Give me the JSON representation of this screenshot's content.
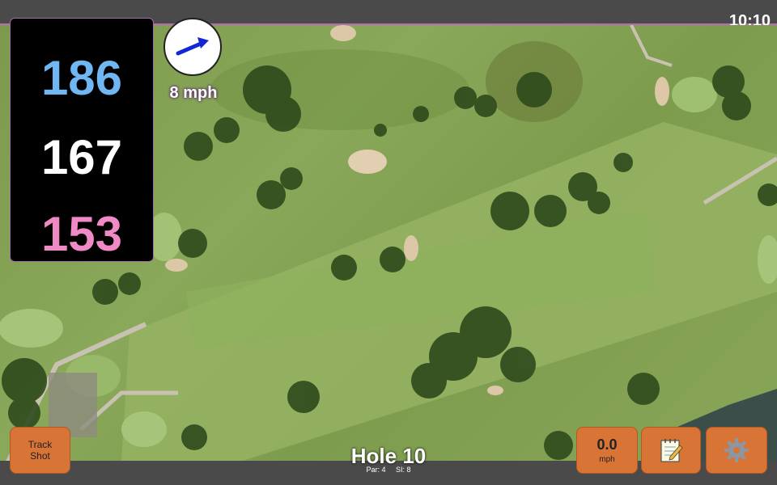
{
  "clock": "10:10",
  "distances": {
    "back": "186",
    "middle": "167",
    "front": "153"
  },
  "wind": {
    "speed_label": "8 mph",
    "direction_icon": "arrow-northeast"
  },
  "hole": {
    "title": "Hole 10",
    "par_label": "Par: 4",
    "si_label": "SI: 8"
  },
  "buttons": {
    "track_line1": "Track",
    "track_line2": "Shot",
    "speed_value": "0.0",
    "speed_unit": "mph",
    "notes_icon": "notepad-icon",
    "settings_icon": "gear-icon"
  },
  "colors": {
    "back_distance": "#6fb6f2",
    "middle_distance": "#ffffff",
    "front_distance": "#f08ac7",
    "button_bg": "#d87435",
    "accent_line": "#b46bb8"
  }
}
